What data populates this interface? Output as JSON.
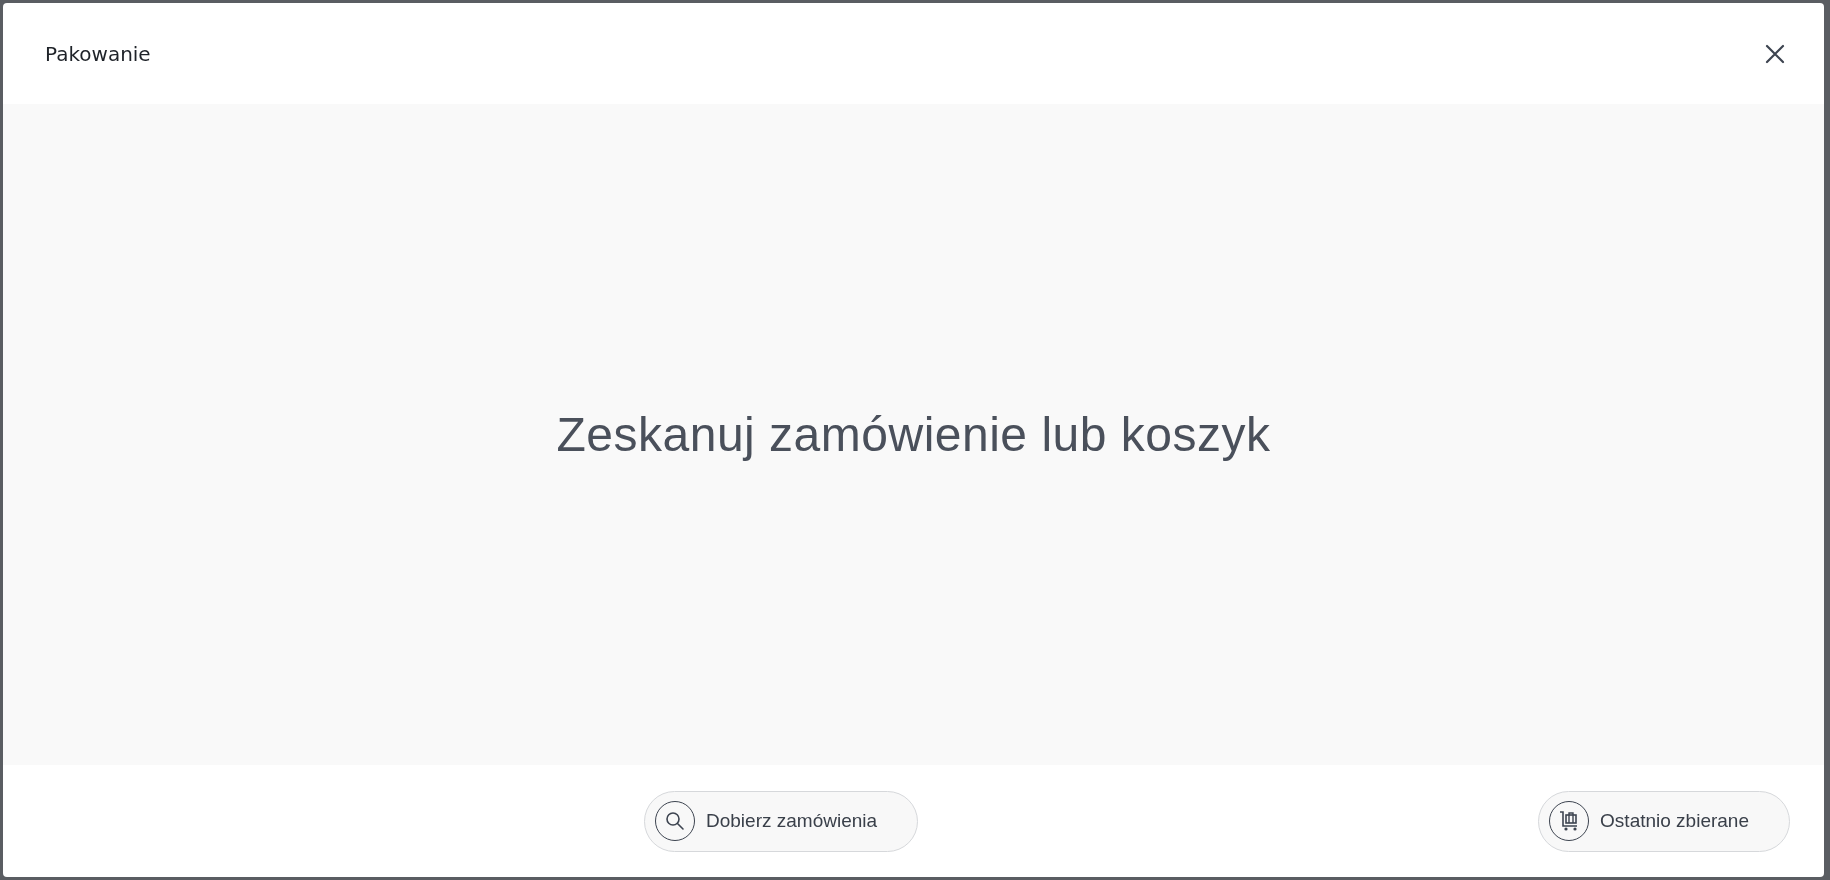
{
  "dialog": {
    "title": "Pakowanie"
  },
  "message": "Zeskanuj zamówienie lub koszyk",
  "buttons": [
    {
      "kind": "search",
      "label": "Dobierz zamówienia"
    },
    {
      "kind": "cart",
      "label": "Ostatnio zbierane"
    }
  ]
}
